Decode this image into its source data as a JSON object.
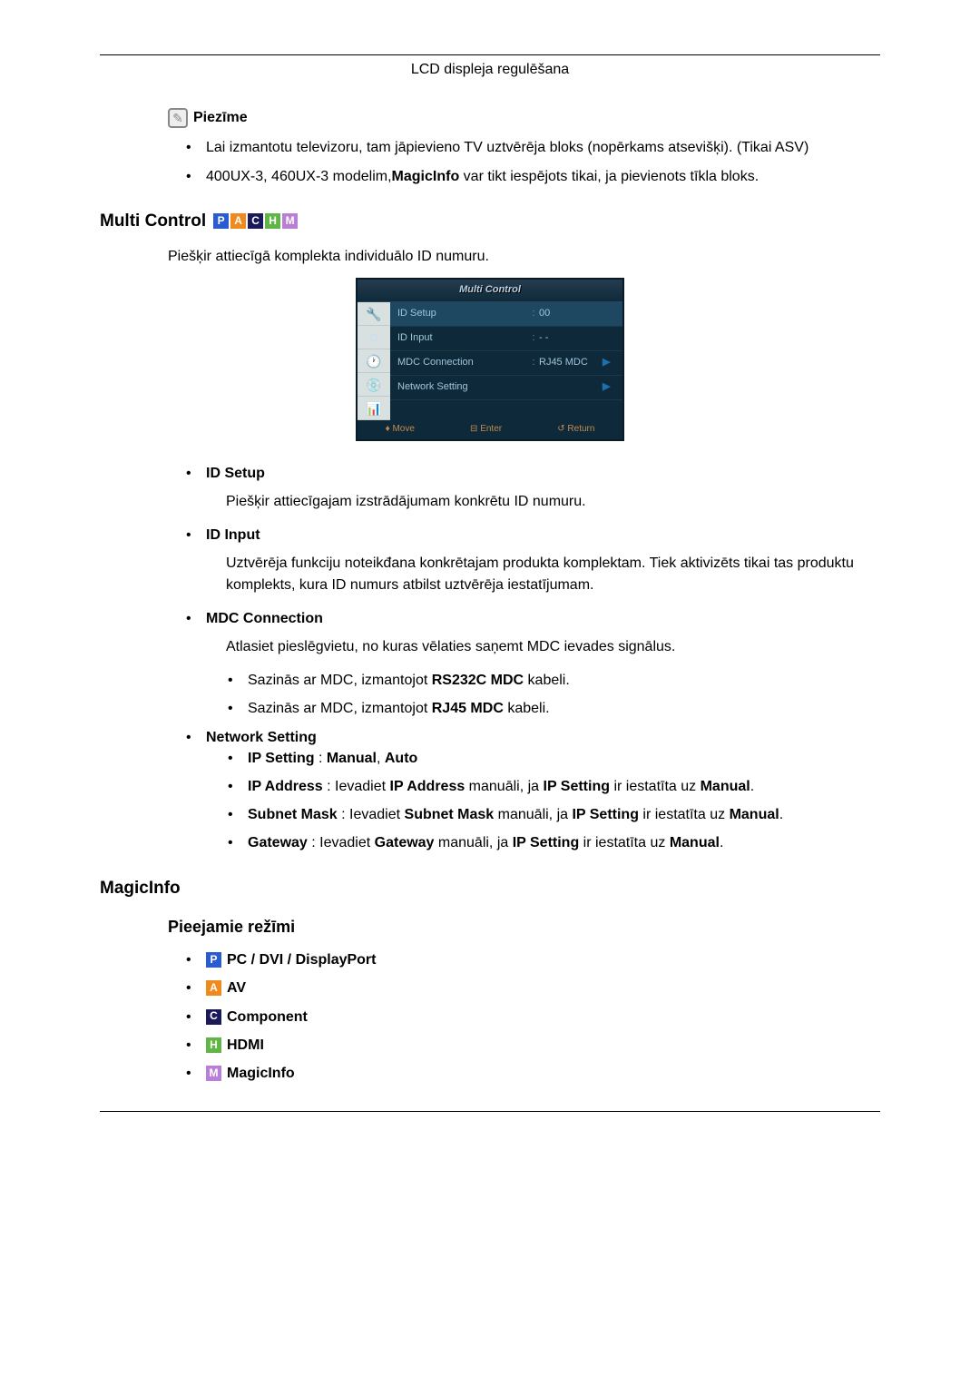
{
  "header": {
    "title": "LCD displeja regulēšana"
  },
  "note": {
    "label": "Piezīme",
    "items": [
      {
        "text_parts": [
          {
            "t": "Lai izmantotu televizoru, tam jāpievieno TV uztvērēja bloks (nopērkams atsevišķi). (Tikai ASV)",
            "b": false
          }
        ]
      },
      {
        "text_parts": [
          {
            "t": "400UX-3, 460UX-3 modelim,",
            "b": false
          },
          {
            "t": "MagicInfo",
            "b": true
          },
          {
            "t": " var tikt iespējots tikai, ja pievienots tīkla bloks.",
            "b": false
          }
        ]
      }
    ]
  },
  "multi_control": {
    "heading": "Multi Control",
    "badges": [
      "P",
      "A",
      "C",
      "H",
      "M"
    ],
    "intro": "Piešķir attiecīgā komplekta individuālo ID numuru.",
    "osd": {
      "title": "Multi Control",
      "rows": [
        {
          "label": "ID Setup",
          "colon": ":",
          "val": "00",
          "arrow": "",
          "sel": true
        },
        {
          "label": "ID Input",
          "colon": ":",
          "val": "- -",
          "arrow": "",
          "sel": false
        },
        {
          "label": "MDC Connection",
          "colon": ":",
          "val": "RJ45 MDC",
          "arrow": "▶",
          "sel": false
        },
        {
          "label": "Network Setting",
          "colon": "",
          "val": "",
          "arrow": "▶",
          "sel": false
        }
      ],
      "footer": {
        "move": "Move",
        "enter": "Enter",
        "ret": "Return"
      }
    },
    "items": [
      {
        "title": "ID Setup",
        "desc_parts": [
          {
            "t": "Piešķir attiecīgajam izstrādājumam konkrētu ID numuru.",
            "b": false
          }
        ]
      },
      {
        "title": "ID Input",
        "desc_parts": [
          {
            "t": "Uztvērēja funkciju noteikđana konkrētajam produkta komplektam. Tiek aktivizēts tikai tas produktu komplekts, kura ID numurs atbilst uztvērēja iestatījumam.",
            "b": false
          }
        ]
      },
      {
        "title": "MDC Connection",
        "desc_parts": [
          {
            "t": "Atlasiet pieslēgvietu, no kuras vēlaties saņemt MDC ievades signālus.",
            "b": false
          }
        ],
        "sub": [
          {
            "parts": [
              {
                "t": "Sazinās ar MDC, izmantojot ",
                "b": false
              },
              {
                "t": "RS232C MDC",
                "b": true
              },
              {
                "t": " kabeli.",
                "b": false
              }
            ]
          },
          {
            "parts": [
              {
                "t": "Sazinās ar MDC, izmantojot ",
                "b": false
              },
              {
                "t": "RJ45 MDC",
                "b": true
              },
              {
                "t": " kabeli.",
                "b": false
              }
            ]
          }
        ]
      },
      {
        "title": "Network Setting",
        "sub": [
          {
            "parts": [
              {
                "t": "IP Setting",
                "b": true
              },
              {
                "t": " : ",
                "b": false
              },
              {
                "t": "Manual",
                "b": true
              },
              {
                "t": ", ",
                "b": false
              },
              {
                "t": "Auto",
                "b": true
              }
            ]
          },
          {
            "parts": [
              {
                "t": "IP Address",
                "b": true
              },
              {
                "t": " : Ievadiet ",
                "b": false
              },
              {
                "t": "IP Address",
                "b": true
              },
              {
                "t": " manuāli, ja ",
                "b": false
              },
              {
                "t": "IP Setting",
                "b": true
              },
              {
                "t": " ir iestatīta uz ",
                "b": false
              },
              {
                "t": "Manual",
                "b": true
              },
              {
                "t": ".",
                "b": false
              }
            ]
          },
          {
            "parts": [
              {
                "t": "Subnet Mask",
                "b": true
              },
              {
                "t": " : Ievadiet ",
                "b": false
              },
              {
                "t": "Subnet Mask",
                "b": true
              },
              {
                "t": " manuāli, ja ",
                "b": false
              },
              {
                "t": "IP Setting",
                "b": true
              },
              {
                "t": " ir iestatīta uz ",
                "b": false
              },
              {
                "t": "Manual",
                "b": true
              },
              {
                "t": ".",
                "b": false
              }
            ]
          },
          {
            "parts": [
              {
                "t": "Gateway",
                "b": true
              },
              {
                "t": " : Ievadiet ",
                "b": false
              },
              {
                "t": "Gateway",
                "b": true
              },
              {
                "t": " manuāli, ja ",
                "b": false
              },
              {
                "t": "IP Setting",
                "b": true
              },
              {
                "t": " ir iestatīta uz ",
                "b": false
              },
              {
                "t": "Manual",
                "b": true
              },
              {
                "t": ".",
                "b": false
              }
            ]
          }
        ]
      }
    ]
  },
  "magicinfo": {
    "heading": "MagicInfo",
    "modes_heading": "Pieejamie režīmi",
    "modes": [
      {
        "badge": "P",
        "label": "PC / DVI / DisplayPort"
      },
      {
        "badge": "A",
        "label": "AV"
      },
      {
        "badge": "C",
        "label": "Component"
      },
      {
        "badge": "H",
        "label": "HDMI"
      },
      {
        "badge": "M",
        "label": "MagicInfo"
      }
    ]
  }
}
